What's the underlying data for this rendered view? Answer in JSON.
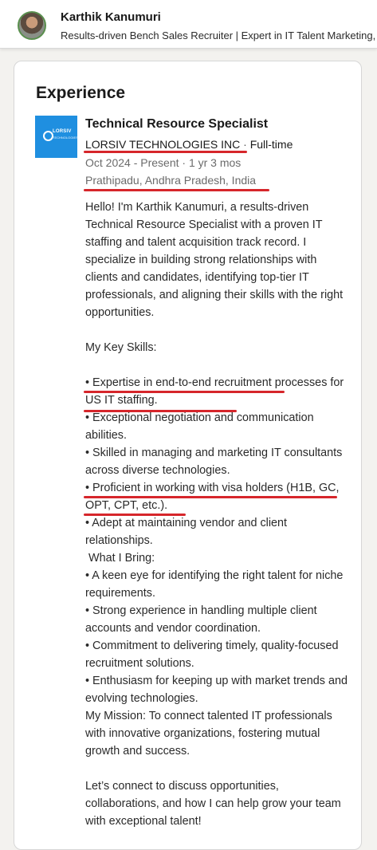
{
  "header": {
    "name": "Karthik Kanumuri",
    "headline": "Results-driven Bench Sales Recruiter | Expert in IT Talent Marketing,"
  },
  "experience": {
    "section_title": "Experience",
    "logo_text": "LORSIV",
    "logo_subtext": "TECHNOLOGIES",
    "job_title": "Technical Resource Specialist",
    "company": "LORSIV TECHNOLOGIES INC",
    "separator": " · ",
    "employment_type": "Full-time",
    "dates": "Oct 2024 - Present · 1 yr 3 mos",
    "location": "Prathipadu, Andhra Pradesh, India",
    "description": [
      "Hello! I'm Karthik Kanumuri, a results-driven Technical Resource Specialist with a proven IT staffing and talent acquisition track record. I specialize in building strong relationships with clients and candidates, identifying top-tier IT professionals, and aligning their skills with the right opportunities.",
      "",
      "My Key Skills:",
      "",
      "• Expertise in end-to-end recruitment processes for US IT staffing.",
      "• Exceptional negotiation and communication abilities.",
      "• Skilled in managing and marketing IT consultants across diverse technologies.",
      "• Proficient in working with visa holders (H1B, GC, OPT, CPT, etc.).",
      "• Adept at maintaining vendor and client relationships.",
      " What I Bring:",
      "• A keen eye for identifying the right talent for niche requirements.",
      "• Strong experience in handling multiple client accounts and vendor coordination.",
      "• Commitment to delivering timely, quality-focused recruitment solutions.",
      "• Enthusiasm for keeping up with market trends and evolving technologies.",
      "My Mission: To connect talented IT professionals with innovative organizations, fostering mutual growth and success.",
      "",
      "Let’s connect to discuss opportunities, collaborations, and how I can help grow your team with exceptional talent!"
    ]
  },
  "colors": {
    "accent_logo": "#1f8fe0",
    "annotation_red": "#d6262b",
    "page_background": "#f3f2ef"
  }
}
